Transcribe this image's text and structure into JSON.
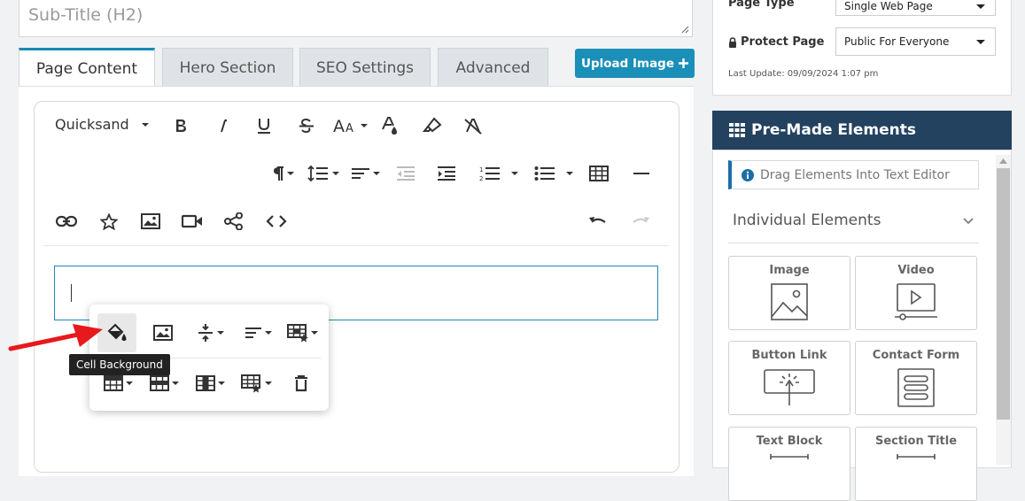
{
  "subtitle": {
    "placeholder": "Sub-Title (H2)"
  },
  "tabs": [
    {
      "label": "Page Content",
      "active": true
    },
    {
      "label": "Hero Section",
      "active": false
    },
    {
      "label": "SEO Settings",
      "active": false
    },
    {
      "label": "Advanced",
      "active": false
    }
  ],
  "upload_button": {
    "label": "Upload Image",
    "icon": "plus-icon"
  },
  "editor": {
    "font_family_value": "Quicksand",
    "toolbar_row1": [
      "bold-icon",
      "italic-icon",
      "underline-icon",
      "strikethrough-icon",
      "font-size-icon",
      "text-color-icon",
      "highlight-icon",
      "clear-format-icon"
    ],
    "toolbar_row2": [
      "paragraph-format-icon",
      "line-height-icon",
      "align-icon",
      "outdent-icon",
      "indent-icon",
      "ordered-list-icon",
      "unordered-list-icon",
      "table-icon",
      "horizontal-rule-icon"
    ],
    "toolbar_row3": [
      "link-icon",
      "star-icon",
      "image-icon",
      "video-icon",
      "share-icon",
      "code-view-icon",
      "undo-icon",
      "redo-icon"
    ]
  },
  "table_popup": {
    "row1": [
      "cell-background-icon",
      "image-icon",
      "vertical-align-icon",
      "horizontal-align-icon",
      "table-style-icon"
    ],
    "row2": [
      "table-header-icon",
      "table-rows-icon",
      "table-columns-icon",
      "cell-style-icon",
      "delete-table-icon"
    ],
    "tooltip": "Cell Background"
  },
  "settings": {
    "page_type_label": "Page Type",
    "page_type_value": "Single Web Page",
    "protect_label": "Protect Page",
    "protect_value": "Public For Everyone",
    "last_update": "Last Update: 09/09/2024 1:07 pm"
  },
  "premade": {
    "title": "Pre-Made Elements",
    "hint": "Drag Elements Into Text Editor",
    "section": "Individual Elements",
    "elements": [
      {
        "label": "Image",
        "icon": "image-icon"
      },
      {
        "label": "Video",
        "icon": "video-icon"
      },
      {
        "label": "Button Link",
        "icon": "button-link-icon"
      },
      {
        "label": "Contact Form",
        "icon": "contact-form-icon"
      },
      {
        "label": "Text Block",
        "icon": "text-block-icon"
      },
      {
        "label": "Section Title",
        "icon": "section-title-icon"
      }
    ]
  },
  "colors": {
    "accent": "#1a8ab5",
    "header": "#23425f",
    "arrow": "#e8191c"
  }
}
